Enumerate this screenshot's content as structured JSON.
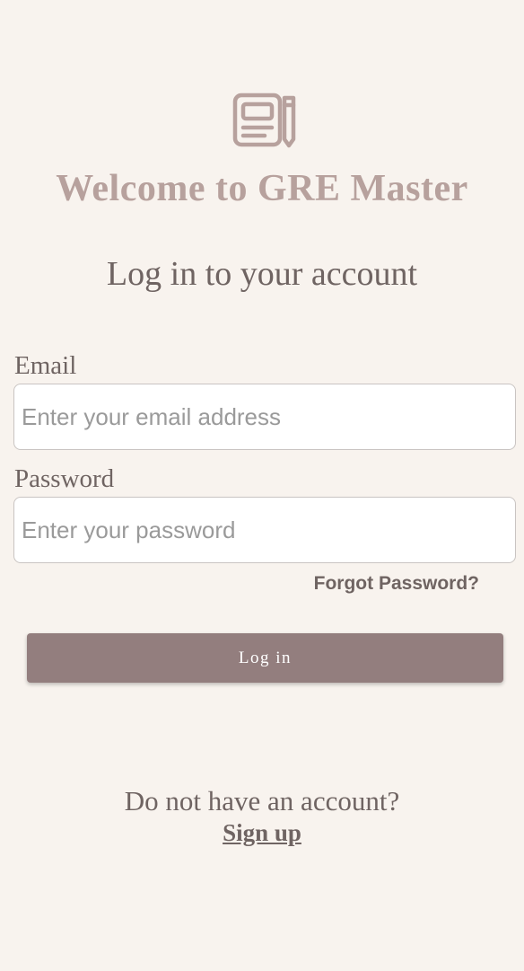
{
  "header": {
    "logo_icon": "notebook-pencil-icon",
    "welcome": "Welcome to GRE Master",
    "subtitle": "Log in to your account"
  },
  "form": {
    "email_label": "Email",
    "email_placeholder": "Enter your email address",
    "email_value": "",
    "password_label": "Password",
    "password_placeholder": "Enter your password",
    "password_value": "",
    "forgot_label": "Forgot Password?",
    "login_label": "Log in"
  },
  "footer": {
    "prompt": "Do not have an account?",
    "signup_label": "Sign up"
  },
  "colors": {
    "background": "#f8f3ee",
    "accent": "#937e7e",
    "title": "#b7a19d",
    "text": "#6f6462"
  }
}
